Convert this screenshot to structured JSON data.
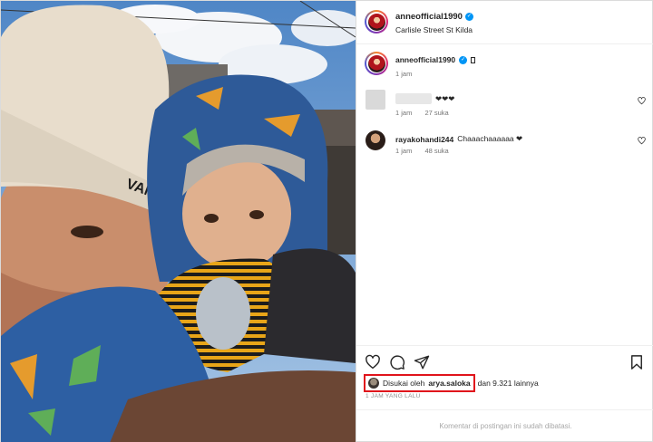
{
  "post": {
    "username": "anneofficial1990",
    "location": "Carlisle Street St Kilda",
    "verified": true
  },
  "caption": {
    "username": "anneofficial1990",
    "time": "1 jam"
  },
  "comments": [
    {
      "username": "",
      "text": "❤❤❤",
      "time": "1 jam",
      "likes": "27 suka"
    },
    {
      "username": "rayakohandi244",
      "text": "Chaaachaaaaaa ❤",
      "time": "1 jam",
      "likes": "48 suka"
    }
  ],
  "actions": {
    "like_icon": "heart-icon",
    "comment_icon": "comment-icon",
    "share_icon": "share-icon",
    "save_icon": "bookmark-icon"
  },
  "likes": {
    "prefix": "Disukai oleh",
    "user": "arya.saloka",
    "suffix": "dan 9.321 lainnya"
  },
  "posted_ago": "1 JAM YANG LALU",
  "footer_note": "Komentar di postingan ini sudah dibatasi.",
  "colors": {
    "verified": "#0095f6",
    "highlight_box": "#e0141c",
    "meta_text": "#737373"
  }
}
